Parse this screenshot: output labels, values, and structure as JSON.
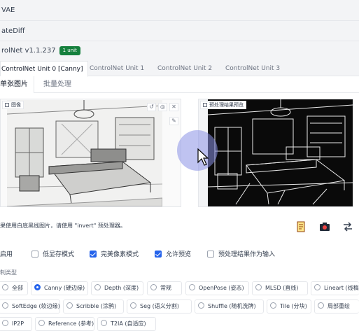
{
  "accordions": {
    "vae": "VAE",
    "animatediff": "ateDiff",
    "controlnet_title": "rolNet v1.1.237",
    "controlnet_badge": "1 unit"
  },
  "unit_tabs": [
    {
      "label": "ControlNet Unit 0 [Canny]",
      "active": true
    },
    {
      "label": "ControlNet Unit 1",
      "active": false
    },
    {
      "label": "ControlNet Unit 2",
      "active": false
    },
    {
      "label": "ControlNet Unit 3",
      "active": false
    }
  ],
  "sub_tabs": [
    {
      "label": "单张图片",
      "active": true
    },
    {
      "label": "批量处理",
      "active": false
    }
  ],
  "image_panel": {
    "label": "图像"
  },
  "preview_panel": {
    "label": "预处理结果预览"
  },
  "info_text": "果使用白底黑线图片，请使用 \"invert\" 预处理器。",
  "checkboxes": [
    {
      "label": "启用",
      "checked": false
    },
    {
      "label": "低显存模式",
      "checked": false
    },
    {
      "label": "完美像素模式",
      "checked": true
    },
    {
      "label": "允许预览",
      "checked": true
    },
    {
      "label": "预处理结果作为输入",
      "checked": false
    }
  ],
  "control_type_label": "制类型",
  "control_types": [
    {
      "label": "全部",
      "selected": false
    },
    {
      "label": "Canny (硬边缘)",
      "selected": true
    },
    {
      "label": "Depth (深度)",
      "selected": false
    },
    {
      "label": "常规",
      "selected": false
    },
    {
      "label": "OpenPose (姿态)",
      "selected": false
    },
    {
      "label": "MLSD (直线)",
      "selected": false
    },
    {
      "label": "Lineart (线稿",
      "selected": false
    },
    {
      "label": "SoftEdge (软边缘)",
      "selected": false
    },
    {
      "label": "Scribble (涂鸦)",
      "selected": false
    },
    {
      "label": "Seg (语义分割)",
      "selected": false
    },
    {
      "label": "Shuffle (随机洗牌)",
      "selected": false
    },
    {
      "label": "Tile (分块)",
      "selected": false
    },
    {
      "label": "局部重绘",
      "selected": false
    },
    {
      "label": "IP2P",
      "selected": false
    },
    {
      "label": "Reference (参考)",
      "selected": false
    },
    {
      "label": "T2IA (自适应)",
      "selected": false
    }
  ],
  "colors": {
    "accent": "#2563eb",
    "badge": "#15803d"
  }
}
